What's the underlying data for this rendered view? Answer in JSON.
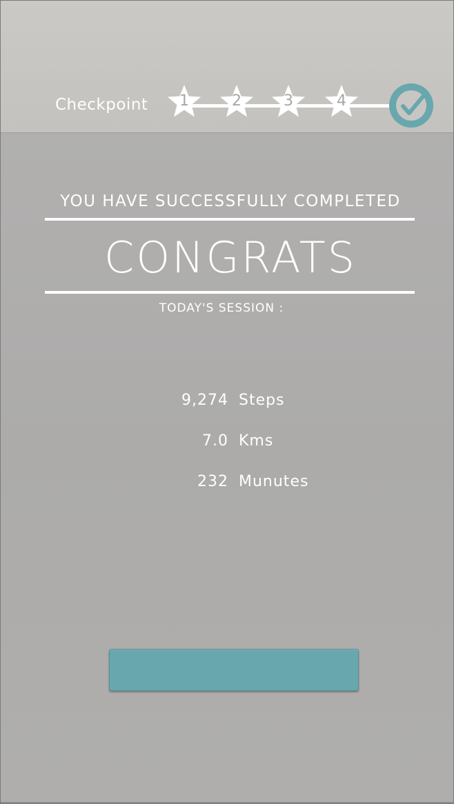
{
  "header": {
    "checkpoint_label": "Checkpoint",
    "checkpoints": [
      {
        "label": "1",
        "state": "completed"
      },
      {
        "label": "2",
        "state": "completed"
      },
      {
        "label": "3",
        "state": "completed"
      },
      {
        "label": "4",
        "state": "completed"
      }
    ],
    "final_badge_icon": "check-circle-icon"
  },
  "main": {
    "headline": "YOU HAVE SUCCESSFULLY COMPLETED",
    "title": "CONGRATS",
    "session_label": "TODAY'S SESSION :",
    "stats": [
      {
        "value": "9,274",
        "unit": "Steps"
      },
      {
        "value": "7.0",
        "unit": "Kms"
      },
      {
        "value": "232",
        "unit": "Munutes"
      }
    ],
    "action_button_label": ""
  },
  "colors": {
    "accent": "#68a7ad",
    "header_bg": "#c8c6c3",
    "body_bg": "#aeadac",
    "text": "#ffffff"
  }
}
